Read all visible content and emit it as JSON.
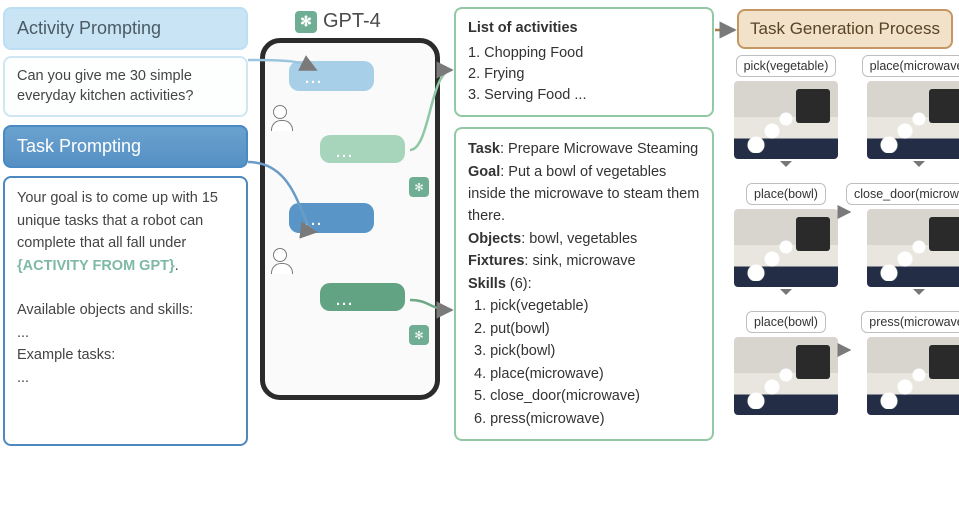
{
  "left": {
    "activity_header": "Activity Prompting",
    "activity_body": "Can you give me 30 simple everyday kitchen activities?",
    "task_header": "Task Prompting",
    "task_body_l1": "Your goal is to come up with 15 unique tasks that a robot can complete that all fall under ",
    "task_body_highlight": "{ACTIVITY FROM GPT}",
    "task_body_l2": ".",
    "task_body_l3": "Available objects and skills:",
    "task_body_l4": "...",
    "task_body_l5": "Example tasks:",
    "task_body_l6": "..."
  },
  "gpt_label": "GPT-4",
  "bubbles": {
    "dots": "..."
  },
  "mid": {
    "activities_title": "List of activities",
    "activities": [
      "1. Chopping Food",
      "2. Frying",
      "3. Serving Food ..."
    ],
    "task_label": "Task",
    "task_value": ": Prepare Microwave Steaming",
    "goal_label": "Goal",
    "goal_value": ": Put a bowl of vegetables inside the microwave to steam them there.",
    "objects_label": "Objects",
    "objects_value": ": bowl, vegetables",
    "fixtures_label": "Fixtures",
    "fixtures_value": ": sink, microwave",
    "skills_label": "Skills",
    "skills_count": " (6):",
    "skills": [
      "1. pick(vegetable)",
      "2. put(bowl)",
      "3. pick(bowl)",
      "4. place(microwave)",
      "5. close_door(microwave)",
      "6. press(microwave)"
    ]
  },
  "right": {
    "header": "Task Generation Process",
    "steps": [
      "pick(vegetable)",
      "place(microwave)",
      "place(bowl)",
      "close_door(microwave)",
      "place(bowl)",
      "press(microwave)"
    ]
  },
  "chart_data": {
    "type": "table",
    "description": "Pipeline diagram: LLM prompting (activity & task), GPT-4 chat, resulting activity list and task spec, and a 6-step task generation rollout.",
    "activity_prompt": "Can you give me 30 simple everyday kitchen activities?",
    "task_prompt_template": "Your goal is to come up with 15 unique tasks that a robot can complete that all fall under {ACTIVITY}. Available objects and skills: ... Example tasks: ...",
    "model": "GPT-4",
    "activities_sample": [
      "Chopping Food",
      "Frying",
      "Serving Food"
    ],
    "generated_task": {
      "name": "Prepare Microwave Steaming",
      "goal": "Put a bowl of vegetables inside the microwave to steam them there.",
      "objects": [
        "bowl",
        "vegetables"
      ],
      "fixtures": [
        "sink",
        "microwave"
      ],
      "skills": [
        "pick(vegetable)",
        "put(bowl)",
        "pick(bowl)",
        "place(microwave)",
        "close_door(microwave)",
        "press(microwave)"
      ]
    },
    "rollout_steps": [
      "pick(vegetable)",
      "place(microwave)",
      "place(bowl)",
      "close_door(microwave)",
      "place(bowl)",
      "press(microwave)"
    ]
  }
}
